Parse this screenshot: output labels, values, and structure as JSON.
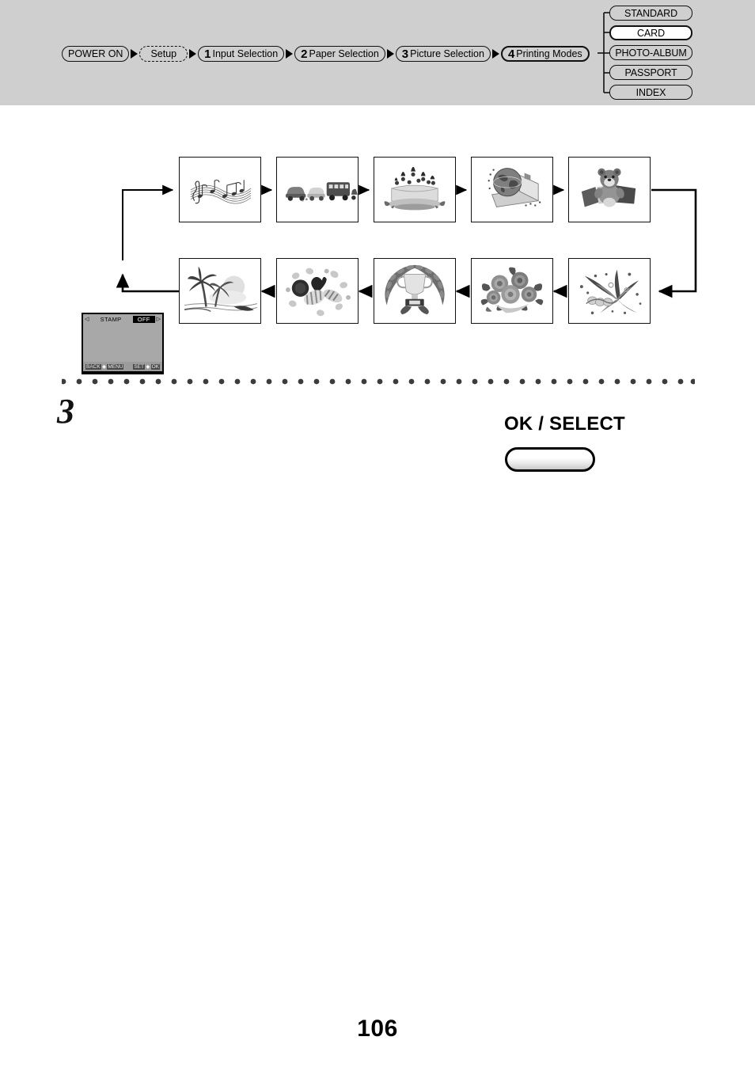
{
  "header": {
    "breadcrumb": [
      {
        "num": "",
        "label": "POWER ON",
        "style": "solid"
      },
      {
        "num": "",
        "label": "Setup",
        "style": "dashed"
      },
      {
        "num": "1",
        "label": "Input Selection",
        "style": "solid"
      },
      {
        "num": "2",
        "label": "Paper Selection",
        "style": "solid"
      },
      {
        "num": "3",
        "label": "Picture Selection",
        "style": "solid"
      },
      {
        "num": "4",
        "label": "Printing Modes",
        "style": "strong"
      }
    ],
    "modes": [
      {
        "label": "STANDARD",
        "selected": false
      },
      {
        "label": "CARD",
        "selected": true
      },
      {
        "label": "PHOTO-ALBUM",
        "selected": false
      },
      {
        "label": "PASSPORT",
        "selected": false
      },
      {
        "label": "INDEX",
        "selected": false
      }
    ]
  },
  "lcd": {
    "left_caret": "◁",
    "right_caret": "▷",
    "setting_label": "STAMP",
    "setting_value": "OFF",
    "hint_left_action": "BACK",
    "hint_left_key": "MENU",
    "hint_right_action": "SET",
    "hint_right_key": "OK",
    "hint_dot": "◆"
  },
  "flow": {
    "thumbnails_top": [
      {
        "name": "music-notes-thumbnail",
        "caption": "Music notes"
      },
      {
        "name": "vehicles-thumbnail",
        "caption": "Cars and bus"
      },
      {
        "name": "birthday-cake-thumbnail",
        "caption": "Birthday cake"
      },
      {
        "name": "travel-globe-thumbnail",
        "caption": "Globe and suitcase"
      },
      {
        "name": "teddy-bear-thumbnail",
        "caption": "Teddy bear with gifts"
      }
    ],
    "thumbnails_bottom": [
      {
        "name": "beach-palms-thumbnail",
        "caption": "Palm trees and beach"
      },
      {
        "name": "candy-hearts-thumbnail",
        "caption": "Candy and sweets"
      },
      {
        "name": "trophy-laurel-thumbnail",
        "caption": "Trophy with laurel wreath"
      },
      {
        "name": "roses-bouquet-thumbnail",
        "caption": "Bouquet of roses"
      },
      {
        "name": "fireworks-thumbnail",
        "caption": "Fireworks and streamers"
      }
    ]
  },
  "step": {
    "number": "3"
  },
  "button": {
    "ok_select_label": "OK / SELECT"
  },
  "footer": {
    "page_number": "106"
  },
  "colors": {
    "header_band": "#cfcfcf",
    "ink": "#111111",
    "lcd_screen": "#a8a8a8",
    "lcd_bezel": "#000000",
    "selected_fill": "#ffffff"
  }
}
